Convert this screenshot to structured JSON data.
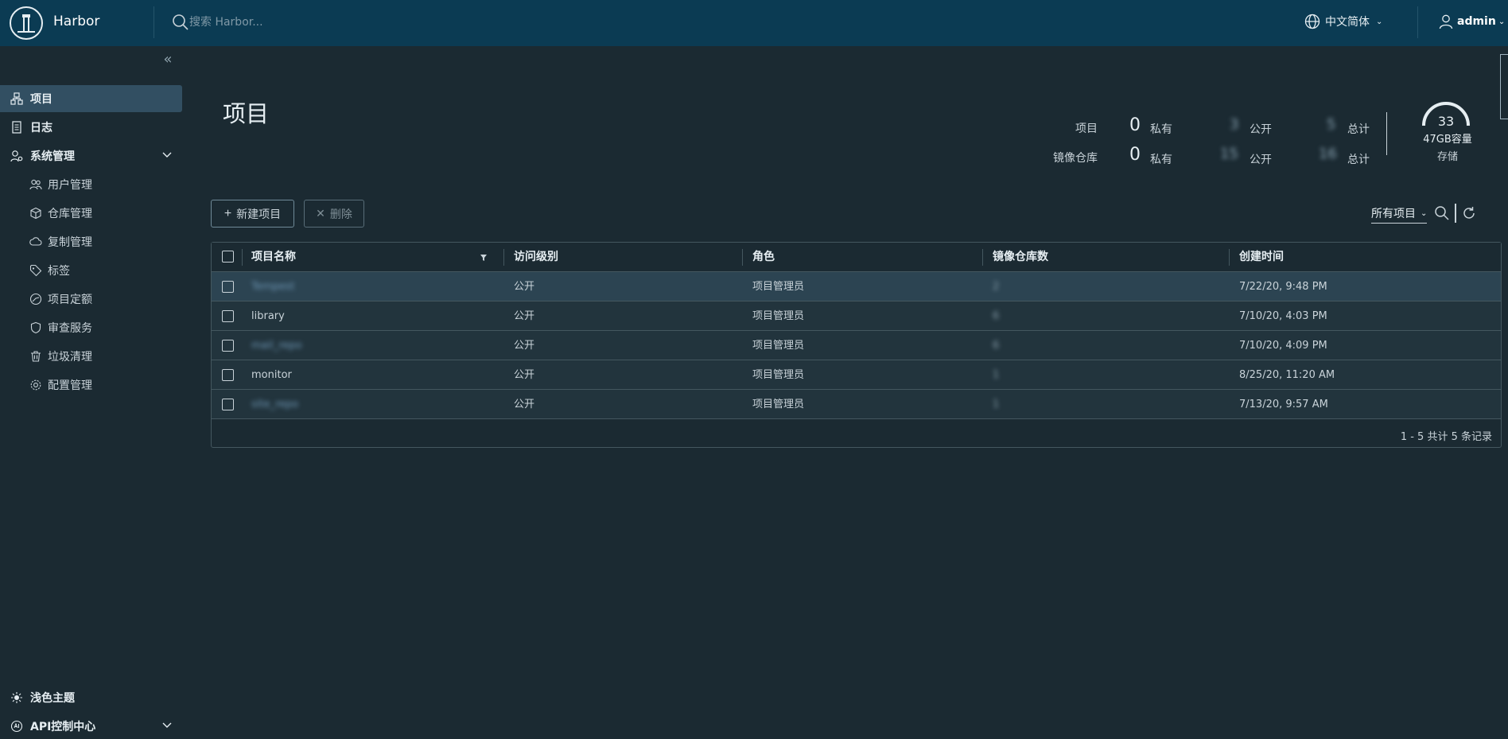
{
  "header": {
    "brand": "Harbor",
    "search_placeholder": "搜索 Harbor...",
    "language": "中文简体",
    "user": "admin"
  },
  "sidebar": {
    "items": [
      {
        "label": "项目",
        "icon": "projects-icon",
        "active": true
      },
      {
        "label": "日志",
        "icon": "logs-icon"
      },
      {
        "label": "系统管理",
        "icon": "admin-icon"
      }
    ],
    "sub_items": [
      {
        "label": "用户管理",
        "icon": "users-icon"
      },
      {
        "label": "仓库管理",
        "icon": "registry-icon"
      },
      {
        "label": "复制管理",
        "icon": "replication-icon"
      },
      {
        "label": "标签",
        "icon": "tag-icon"
      },
      {
        "label": "项目定额",
        "icon": "quota-icon"
      },
      {
        "label": "审查服务",
        "icon": "shield-icon"
      },
      {
        "label": "垃圾清理",
        "icon": "trash-icon"
      },
      {
        "label": "配置管理",
        "icon": "gear-icon"
      }
    ],
    "bottom": [
      {
        "label": "浅色主题",
        "icon": "sun-icon"
      },
      {
        "label": "API控制中心",
        "icon": "api-icon"
      }
    ]
  },
  "main": {
    "title": "项目",
    "stats": {
      "row1_label": "项目",
      "row2_label": "镜像仓库",
      "private_label": "私有",
      "public_label": "公开",
      "total_label": "总计",
      "projects_private": "0",
      "projects_public": "3",
      "projects_total": "5",
      "repos_private": "0",
      "repos_public": "15",
      "repos_total": "16"
    },
    "storage": {
      "value": "33",
      "capacity": "47GB容量",
      "label": "存储"
    },
    "toolbar": {
      "new_project": "新建项目",
      "delete": "删除",
      "filter": "所有项目"
    },
    "table": {
      "columns": [
        "项目名称",
        "访问级别",
        "角色",
        "镜像仓库数",
        "创建时间"
      ],
      "rows": [
        {
          "name": "Tempest",
          "access": "公开",
          "role": "项目管理员",
          "repos": "2",
          "created": "7/22/20, 9:48 PM"
        },
        {
          "name": "library",
          "access": "公开",
          "role": "项目管理员",
          "repos": "6",
          "created": "7/10/20, 4:03 PM"
        },
        {
          "name": "mail_repo",
          "access": "公开",
          "role": "项目管理员",
          "repos": "6",
          "created": "7/10/20, 4:09 PM"
        },
        {
          "name": "monitor",
          "access": "公开",
          "role": "项目管理员",
          "repos": "1",
          "created": "8/25/20, 11:20 AM"
        },
        {
          "name": "site_repo",
          "access": "公开",
          "role": "项目管理员",
          "repos": "1",
          "created": "7/13/20, 9:57 AM"
        }
      ],
      "footer": "1 - 5 共计 5 条记录"
    }
  },
  "colors": {
    "header_bg": "#0b3b53",
    "body_bg": "#1b2a32",
    "active_nav": "#324f62",
    "row_selected": "#2c4452"
  }
}
